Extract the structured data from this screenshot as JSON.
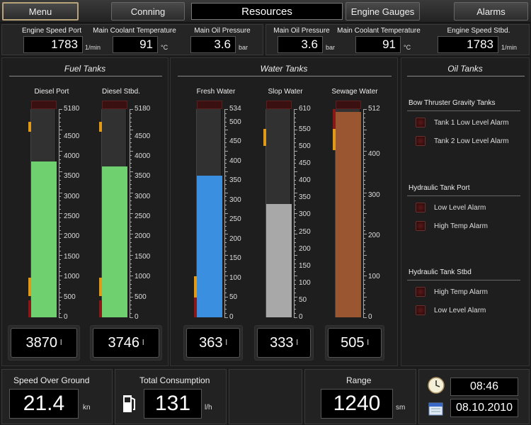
{
  "nav": {
    "menu": "Menu",
    "conning": "Conning",
    "title": "Resources",
    "engine_gauges": "Engine Gauges",
    "alarms": "Alarms"
  },
  "gauges_port": [
    {
      "label": "Engine Speed Port",
      "value": "1783",
      "unit": "1/min"
    },
    {
      "label": "Main Coolant Temperature",
      "value": "91",
      "unit": "°C"
    },
    {
      "label": "Main Oil Pressure",
      "value": "3.6",
      "unit": "bar"
    }
  ],
  "gauges_stbd": [
    {
      "label": "Main Oil Pressure",
      "value": "3.6",
      "unit": "bar"
    },
    {
      "label": "Main Coolant Temperature",
      "value": "91",
      "unit": "°C"
    },
    {
      "label": "Engine Speed Stbd.",
      "value": "1783",
      "unit": "1/min"
    }
  ],
  "fuel": {
    "title": "Fuel Tanks",
    "ticks": [
      "5180",
      "4500",
      "4000",
      "3500",
      "3000",
      "2500",
      "2000",
      "1500",
      "1000",
      "500",
      "0"
    ],
    "tanks": [
      {
        "label": "Diesel Port",
        "level": 3870,
        "max": 5180,
        "readout": "3870",
        "unit": "l",
        "color": "#6fd06f"
      },
      {
        "label": "Diesel Stbd.",
        "level": 3746,
        "max": 5180,
        "readout": "3746",
        "unit": "l",
        "color": "#6fd06f"
      }
    ]
  },
  "water": {
    "title": "Water Tanks",
    "tanks": [
      {
        "label": "Fresh Water",
        "level": 363,
        "max": 534,
        "readout": "363",
        "unit": "l",
        "color": "#3a8fe0",
        "ticks": [
          "534",
          "500",
          "450",
          "400",
          "350",
          "300",
          "250",
          "200",
          "150",
          "100",
          "50",
          "0"
        ]
      },
      {
        "label": "Slop Water",
        "level": 333,
        "max": 610,
        "readout": "333",
        "unit": "l",
        "color": "#a8a8a8",
        "ticks": [
          "610",
          "550",
          "500",
          "450",
          "400",
          "350",
          "300",
          "250",
          "200",
          "150",
          "100",
          "50",
          "0"
        ]
      },
      {
        "label": "Sewage Water",
        "level": 505,
        "max": 512,
        "readout": "505",
        "unit": "l",
        "color": "#9a5630",
        "ticks": [
          "512",
          "400",
          "300",
          "200",
          "100",
          "0"
        ]
      }
    ]
  },
  "oil": {
    "title": "Oil Tanks",
    "groups": [
      {
        "title": "Bow Thruster Gravity Tanks",
        "alarms": [
          "Tank 1 Low Level Alarm",
          "Tank 2 Low Level Alarm"
        ]
      },
      {
        "title": "Hydraulic Tank Port",
        "alarms": [
          "Low Level Alarm",
          "High Temp Alarm"
        ]
      },
      {
        "title": "Hydraulic Tank Stbd",
        "alarms": [
          "High Temp Alarm",
          "Low Level Alarm"
        ]
      }
    ]
  },
  "bottom": {
    "sog": {
      "title": "Speed Over Ground",
      "value": "21.4",
      "unit": "kn"
    },
    "consumption": {
      "title": "Total Consumption",
      "value": "131",
      "unit": "l/h"
    },
    "range": {
      "title": "Range",
      "value": "1240",
      "unit": "sm"
    },
    "time": "08:46",
    "date": "08.10.2010"
  },
  "icons": {
    "clock": "clock-icon",
    "calendar": "calendar-icon",
    "fuel": "fuel-pump-icon"
  }
}
